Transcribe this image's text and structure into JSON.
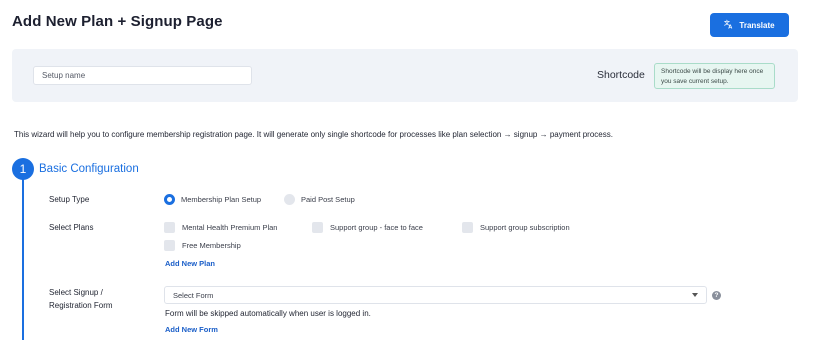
{
  "header": {
    "title": "Add New Plan + Signup Page",
    "translate_label": "Translate"
  },
  "setup": {
    "name_placeholder": "Setup name",
    "name_value": "",
    "shortcode_label": "Shortcode",
    "shortcode_text": "Shortcode will be display here once you save current setup."
  },
  "intro_text": "This wizard will help you to configure membership registration page. It will generate only single shortcode for processes like plan selection → signup → payment process.",
  "step": {
    "number": "1",
    "title": "Basic Configuration"
  },
  "setup_type": {
    "label": "Setup Type",
    "options": [
      {
        "label": "Membership Plan Setup",
        "selected": true
      },
      {
        "label": "Paid Post Setup",
        "selected": false
      }
    ]
  },
  "select_plans": {
    "label": "Select Plans",
    "plans": [
      {
        "label": "Mental Health Premium Plan",
        "checked": false
      },
      {
        "label": "Support group - face to face",
        "checked": false
      },
      {
        "label": "Support group subscription",
        "checked": false
      },
      {
        "label": "Free Membership",
        "checked": false
      }
    ],
    "add_link": "Add New Plan"
  },
  "signup_form": {
    "label_line1": "Select Signup /",
    "label_line2": "Registration Form",
    "selected": "Select Form",
    "note": "Form will be skipped automatically when user is logged in.",
    "add_link": "Add New Form"
  },
  "colors": {
    "accent": "#1a6fe0",
    "shortcode_bg": "#e7f6f1"
  },
  "icons": {
    "translate": "translate-icon",
    "help": "help-icon",
    "dropdown": "chevron-down-icon"
  }
}
